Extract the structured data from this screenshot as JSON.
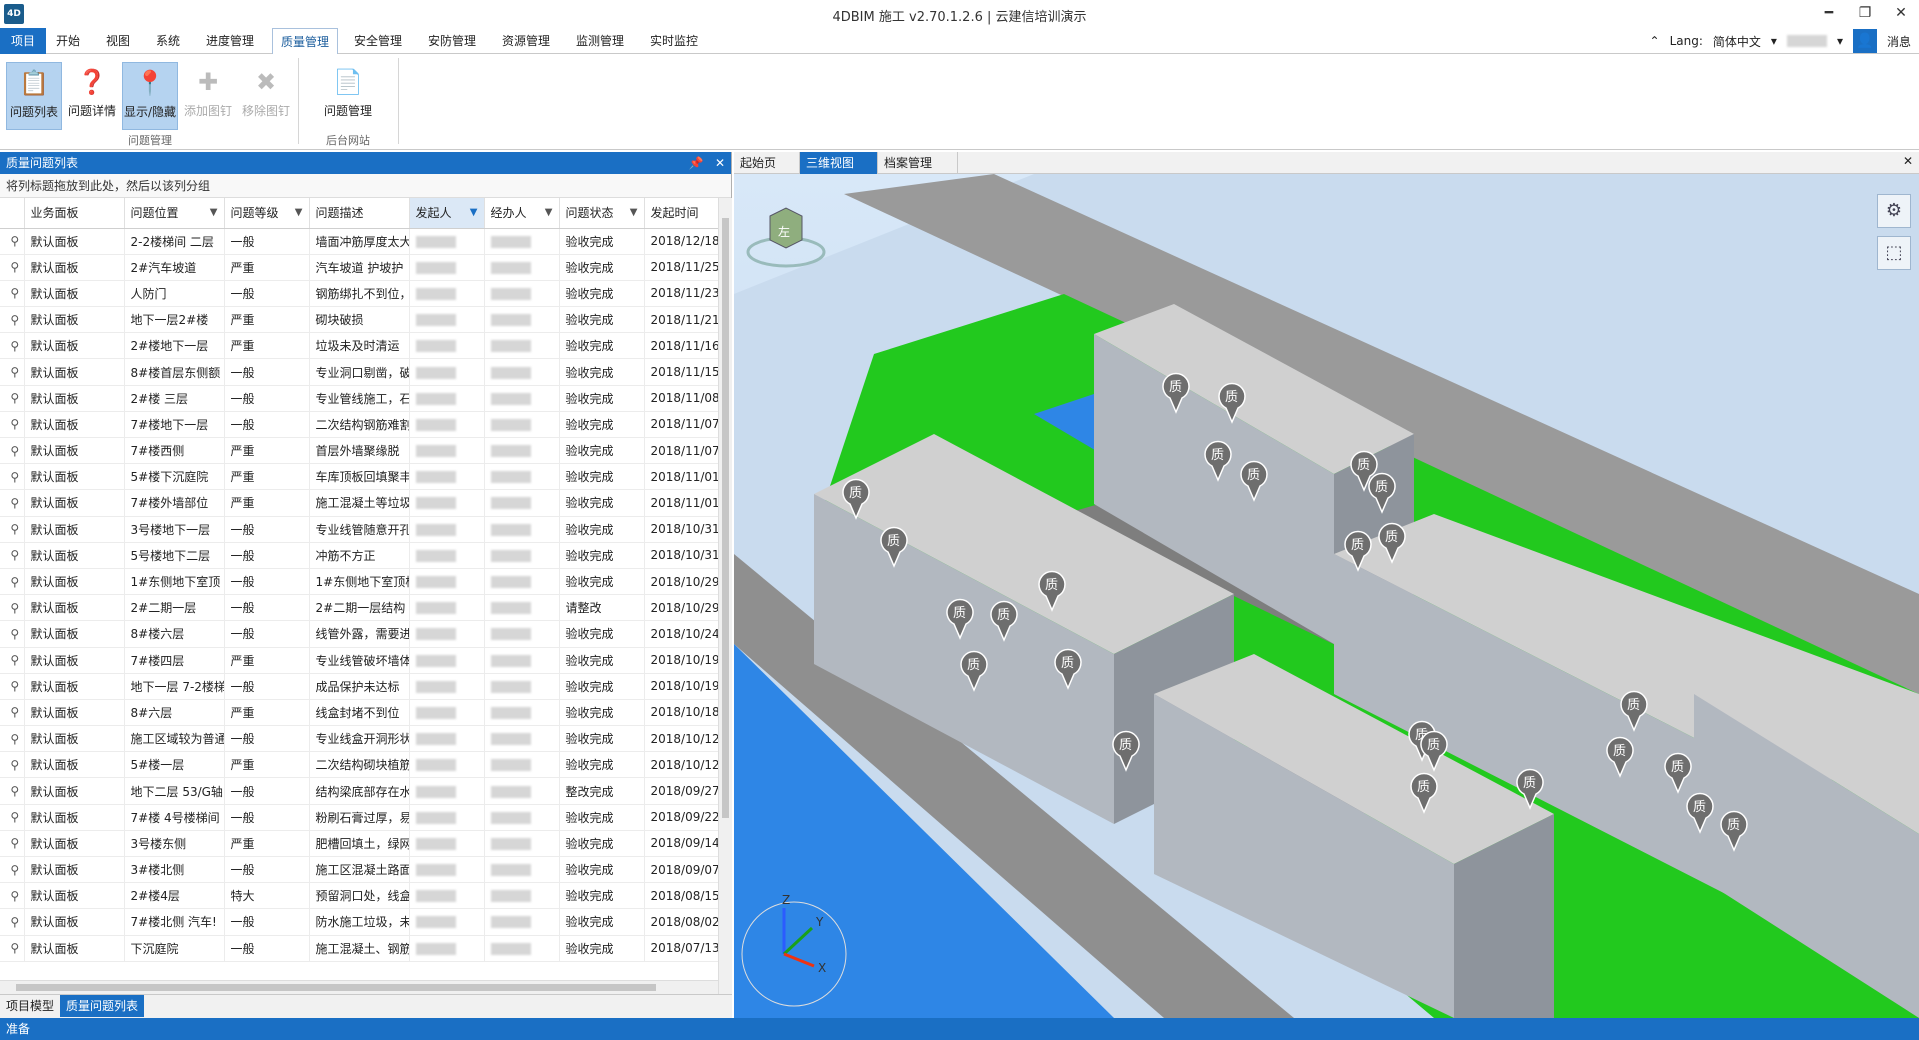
{
  "title": "4DBIM 施工 v2.70.1.2.6 | 云建信培训演示",
  "app_logo": "4D",
  "window_buttons": [
    "━",
    "❐",
    "✕"
  ],
  "menu": {
    "items": [
      "项目",
      "开始",
      "视图",
      "系统",
      "进度管理",
      "质量管理",
      "安全管理",
      "安防管理",
      "资源管理",
      "监测管理",
      "实时监控"
    ],
    "active": "质量管理",
    "lang_label": "Lang:",
    "lang_value": "简体中文",
    "messages": "消息"
  },
  "ribbon": {
    "buttons": [
      {
        "label": "问题列表",
        "icon": "list-doc-icon",
        "state": "selected"
      },
      {
        "label": "问题详情",
        "icon": "question-doc-icon",
        "state": "normal"
      },
      {
        "label": "显示/隐藏",
        "icon": "pin-circle-icon",
        "state": "selected"
      },
      {
        "label": "添加图钉",
        "icon": "pin-add-icon",
        "state": "disabled"
      },
      {
        "label": "移除图钉",
        "icon": "pin-remove-icon",
        "state": "disabled"
      },
      {
        "label": "问题管理",
        "icon": "manage-doc-icon",
        "state": "normal"
      }
    ],
    "groups": [
      "问题管理",
      "后台网站"
    ]
  },
  "left_panel": {
    "title": "质量问题列表",
    "title_icons": [
      "📌",
      "✕"
    ],
    "group_hint": "将列标题拖放到此处，然后以该列分组",
    "columns": [
      "业务面板",
      "问题位置",
      "问题等级",
      "问题描述",
      "发起人",
      "经办人",
      "问题状态",
      "发起时间"
    ],
    "filtered_column": "发起人",
    "rows": [
      [
        "默认面板",
        "2-2楼梯间 二层",
        "一般",
        "墙面冲筋厚度太大",
        "验收完成",
        "2018/12/18"
      ],
      [
        "默认面板",
        "2#汽车坡道",
        "严重",
        "汽车坡道 护坡护",
        "验收完成",
        "2018/11/25"
      ],
      [
        "默认面板",
        "人防门",
        "一般",
        "钢筋绑扎不到位，",
        "验收完成",
        "2018/11/23"
      ],
      [
        "默认面板",
        "地下一层2#楼",
        "严重",
        "砌块破损",
        "验收完成",
        "2018/11/21"
      ],
      [
        "默认面板",
        "2#楼地下一层",
        "严重",
        "垃圾未及时清运",
        "验收完成",
        "2018/11/16"
      ],
      [
        "默认面板",
        "8#楼首层东侧额",
        "一般",
        "专业洞口剔凿，破",
        "验收完成",
        "2018/11/15"
      ],
      [
        "默认面板",
        "2#楼 三层",
        "一般",
        "专业管线施工，石",
        "验收完成",
        "2018/11/08"
      ],
      [
        "默认面板",
        "7#楼地下一层",
        "一般",
        "二次结构钢筋难割",
        "验收完成",
        "2018/11/07"
      ],
      [
        "默认面板",
        "7#楼西侧",
        "严重",
        "首层外墙聚缘脱",
        "验收完成",
        "2018/11/07"
      ],
      [
        "默认面板",
        "5#楼下沉庭院",
        "严重",
        "车库顶板回填聚丰",
        "验收完成",
        "2018/11/01"
      ],
      [
        "默认面板",
        "7#楼外墙部位",
        "严重",
        "施工混凝土等垃圾",
        "验收完成",
        "2018/11/01"
      ],
      [
        "默认面板",
        "3号楼地下一层",
        "一般",
        "专业线管随意开孔",
        "验收完成",
        "2018/10/31"
      ],
      [
        "默认面板",
        "5号楼地下二层",
        "一般",
        "冲筋不方正",
        "验收完成",
        "2018/10/31"
      ],
      [
        "默认面板",
        "1#东侧地下室顶",
        "一般",
        "1#东侧地下室顶板",
        "验收完成",
        "2018/10/29"
      ],
      [
        "默认面板",
        "2#二期一层",
        "一般",
        "2#二期一层结构",
        "请整改",
        "2018/10/29"
      ],
      [
        "默认面板",
        "8#楼六层",
        "一般",
        "线管外露，需要进",
        "验收完成",
        "2018/10/24"
      ],
      [
        "默认面板",
        "7#楼四层",
        "严重",
        "专业线管破坏墙体",
        "验收完成",
        "2018/10/19"
      ],
      [
        "默认面板",
        "地下一层 7-2楼梯",
        "一般",
        "成品保护未达标",
        "验收完成",
        "2018/10/19"
      ],
      [
        "默认面板",
        "8#六层",
        "严重",
        "线盒封堵不到位",
        "验收完成",
        "2018/10/18"
      ],
      [
        "默认面板",
        "施工区域较为普通",
        "一般",
        "专业线盒开洞形状",
        "验收完成",
        "2018/10/12"
      ],
      [
        "默认面板",
        "5#楼一层",
        "严重",
        "二次结构砌块植筋",
        "验收完成",
        "2018/10/12"
      ],
      [
        "默认面板",
        "地下二层 53/G轴",
        "一般",
        "结构梁底部存在水",
        "整改完成",
        "2018/09/27"
      ],
      [
        "默认面板",
        "7#楼 4号楼梯间",
        "一般",
        "粉刷石膏过厚，易",
        "验收完成",
        "2018/09/22"
      ],
      [
        "默认面板",
        "3号楼东侧",
        "严重",
        "肥槽回填土，绿网",
        "验收完成",
        "2018/09/14"
      ],
      [
        "默认面板",
        "3#楼北侧",
        "一般",
        "施工区混凝土路面",
        "验收完成",
        "2018/09/07"
      ],
      [
        "默认面板",
        "2#楼4层",
        "特大",
        "预留洞口处，线盒",
        "验收完成",
        "2018/08/15"
      ],
      [
        "默认面板",
        "7#楼北侧 汽车!",
        "一般",
        "防水施工垃圾，未",
        "验收完成",
        "2018/08/02"
      ],
      [
        "默认面板",
        "下沉庭院",
        "一般",
        "施工混凝土、钢筋",
        "验收完成",
        "2018/07/13"
      ]
    ]
  },
  "bottom_tabs": [
    "项目模型",
    "质量问题列表"
  ],
  "bottom_active": "质量问题列表",
  "doc_tabs": [
    "起始页",
    "三维视图",
    "档案管理"
  ],
  "doc_active": "三维视图",
  "viewport": {
    "marker_label": "质",
    "axis_labels": [
      "Z",
      "Y",
      "X"
    ],
    "cube_face": "左",
    "tool_icons": [
      "explode-icon",
      "view-cube-icon"
    ]
  },
  "status": "准备",
  "colors": {
    "accent": "#1a6fc4",
    "grass": "#22c91e",
    "water": "#2e86e6",
    "building": "#a8a8a8"
  }
}
